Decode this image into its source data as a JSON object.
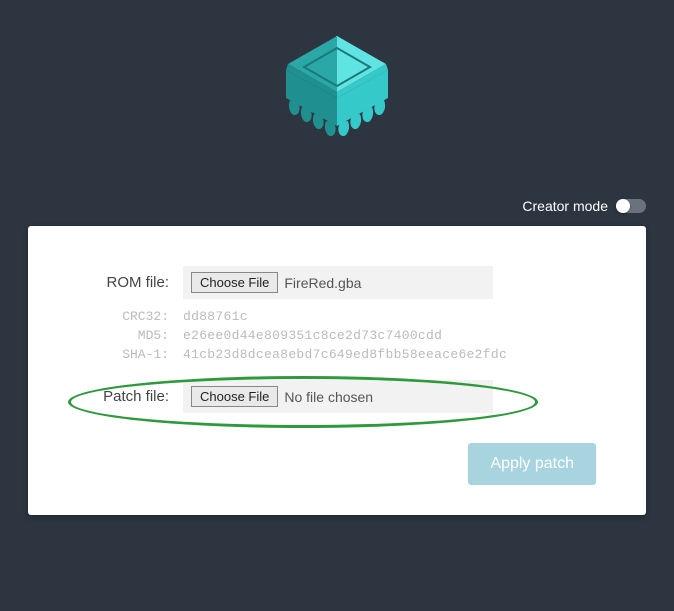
{
  "creator_mode_label": "Creator mode",
  "rom": {
    "label": "ROM file:",
    "choose_btn": "Choose File",
    "filename": "FireRed.gba"
  },
  "hashes": {
    "crc32_label": "CRC32:",
    "crc32_value": "dd88761c",
    "md5_label": "MD5:",
    "md5_value": "e26ee0d44e809351c8ce2d73c7400cdd",
    "sha1_label": "SHA-1:",
    "sha1_value": "41cb23d8dcea8ebd7c649ed8fbb58eeace6e2fdc"
  },
  "patch": {
    "label": "Patch file:",
    "choose_btn": "Choose File",
    "filename": "No file chosen"
  },
  "apply_btn": "Apply patch"
}
